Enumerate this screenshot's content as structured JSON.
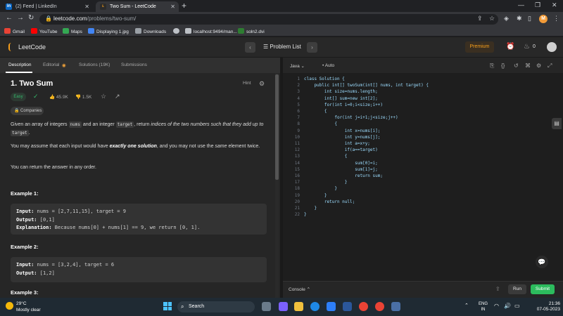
{
  "browser": {
    "tabs": [
      {
        "title": "(2) Feed | LinkedIn",
        "favicon": "in"
      },
      {
        "title": "Two Sum - LeetCode",
        "favicon": "lc"
      }
    ],
    "url_host": "leetcode.com",
    "url_path": "/problems/two-sum/",
    "profile_initial": "M",
    "bookmarks": [
      "Gmail",
      "YouTube",
      "Maps",
      "Displaying 1.jpg",
      "Downloads",
      "localhost:9494/man...",
      "soln2.dvi"
    ]
  },
  "header": {
    "logo_text": "LeetCode",
    "problem_list_label": "Problem List",
    "premium_label": "Premium",
    "streak_count": "0"
  },
  "left": {
    "tabs": [
      "Description",
      "Editorial",
      "Solutions (19K)",
      "Submissions"
    ],
    "title": "1. Two Sum",
    "hint_label": "Hint",
    "difficulty": "Easy",
    "likes": "45.9K",
    "dislikes": "1.5K",
    "companies_label": "Companies",
    "p1_a": "Given an array of integers ",
    "p1_code1": "nums",
    "p1_b": " and an integer ",
    "p1_code2": "target",
    "p1_c": ", return ",
    "p1_em": "indices of the two numbers such that they add up to ",
    "p1_code3": "target",
    "p1_end": ".",
    "p2_a": "You may assume that each input would have ",
    "p2_b": "exactly one solution",
    "p2_c": ", and you may not use the ",
    "p2_em": "same",
    "p2_d": " element twice.",
    "p3": "You can return the answer in any order.",
    "ex1_heading": "Example 1:",
    "ex1_input_label": "Input:",
    "ex1_input": " nums = [2,7,11,15], target = 9",
    "ex1_output_label": "Output:",
    "ex1_output": " [0,1]",
    "ex1_expl_label": "Explanation:",
    "ex1_expl": " Because nums[0] + nums[1] == 9, we return [0, 1].",
    "ex2_heading": "Example 2:",
    "ex2_input_label": "Input:",
    "ex2_input": " nums = [3,2,4], target = 6",
    "ex2_output_label": "Output:",
    "ex2_output": " [1,2]",
    "ex3_heading": "Example 3:"
  },
  "editor": {
    "language": "Java",
    "mode": "Auto",
    "lines": [
      "class Solution {",
      "    public int[] twoSum(int[] nums, int target) {",
      "        int size=nums.length;",
      "        int[] sum=new int[2];",
      "        for(int i=0;i<size;i++)",
      "        {",
      "            for(int j=i+1;j<size;j++)",
      "            {",
      "                int x=nums[i];",
      "                int y=nums[j];",
      "                int a=x+y;",
      "                if(a==target)",
      "                {",
      "                    sum[0]=i;",
      "                    sum[1]=j;",
      "                    return sum;",
      "                }",
      "            }",
      "        }",
      "        return null;",
      "    }",
      "}"
    ],
    "console_label": "Console",
    "run_label": "Run",
    "submit_label": "Submit"
  },
  "taskbar": {
    "temperature": "29°C",
    "weather": "Mostly clear",
    "search_label": "Search",
    "lang_top": "ENG",
    "lang_bottom": "IN",
    "time": "21:36",
    "date": "07-05-2023"
  },
  "colors": {
    "accent_orange": "#f89f1b",
    "easy_green": "#34b86b",
    "submit_green": "#2cbb5d"
  }
}
